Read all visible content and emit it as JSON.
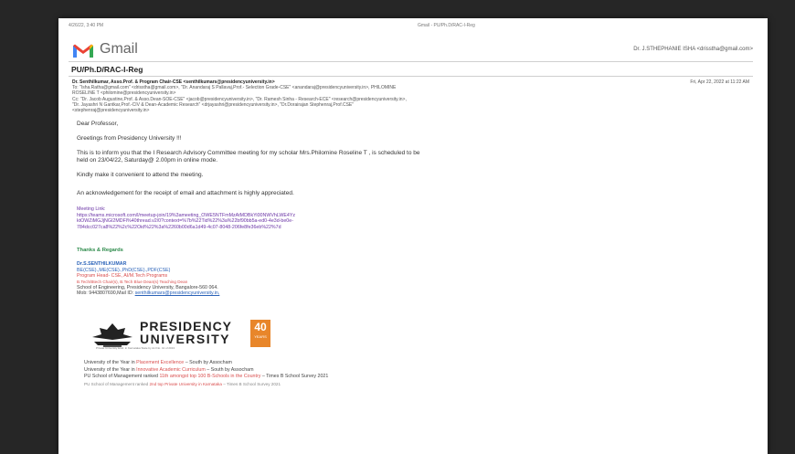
{
  "print_header": {
    "datetime": "4/26/22, 3:40 PM",
    "center": "Gmail - PU/Ph.D/RAC-I-Reg"
  },
  "gmail": {
    "brand": "Gmail",
    "account": "Dr. J.STHEPHANIE ISHA <drisstha@gmail.com>"
  },
  "subject": "PU/Ph.D/RAC-I-Reg",
  "sender": "Dr. Senthilkumar, Asso.Prof. & Program Chair-CSE <senthilkumars@presidencyuniversity.in>",
  "date": "Fri, Apr 22, 2022 at 11:22 AM",
  "recipients": [
    "To: \"Isha.Ratha@gmail.com\" <drisstha@gmail.com>, \"Dr. Anandaraj S Pallavaj,Prof.- Selection Grade-CSE\" <anandaraj@presidencyuniversity.in>, PHILOMINE",
    "ROSELINE T <philomine@presidencyuniversity.in>",
    "Cc: \"Dr. Jacob Augustine,Prof. & Asso.Dean-SOE-CSE\" <jacob@presidencyuniversity.in>, \"Dr. Ramesh Sinha - Research-ECE\" <research@presidencyuniversity.in>,",
    "\"Dr. Jayashri N Gantkar,Prof.-CIV & Dean-Academic Research\" <drjayashri@presidencyuniversity.in>, \"Dr.Dorairajan Stephenraj,Prof.CSE\"",
    "<stephenraj@presidencyuniversity.in>"
  ],
  "body": {
    "salutation": "Dear Professor,",
    "greeting": "Greetings from Presidency University !!!",
    "para1a": "This is to inform you that the I Research Advisory Committee meeting for my scholar Mrs.Philomine Roseline T , is scheduled to be",
    "para1b": "held on 23/04/22, Saturday@ 2.00pm in online mode.",
    "para2": "Kindly make it convenient to attend the meeting.",
    "para3": "An acknowledgement for the receipt of email and attachment is highly appreciated.",
    "meeting_label": "Meeting Link:",
    "meeting_link_1": "https://teams.microsoft.com/l/meetup-join/19%3ameeting_OWE5NTFmMzAtMDBkYi00NWVhLWE4Yz",
    "meeting_link_2": "ktOWZiMGJjNGI2MDFl%40thread.v2/0?context=%7b%22Tid%22%3a%22bf90bb5a-ed0-4e3d-be0e-",
    "meeting_link_3": "784dcc027ca8%22%2c%22Oid%22%3a%2260b00d6a1d49-4c07-8048-206fe8fe36eb%22%7d"
  },
  "signature": {
    "regards": "Thanks & Regards",
    "name": "Dr.S.SENTHILKUMAR",
    "degrees": "BE(CSE).,ME(CSE).,PhD(CSE).,PDF(CSE)",
    "role1": "Program Head- CSE, AI/M.Tech Programs",
    "role2": "B.Tech/Btech Chair(s), B.Tech Blue Dean(s) Teaching Dean",
    "address": "School of Engineering, Presidency University, Bangalore-560 064.",
    "contact_prefix": "Mob: 9443807690,Mail ID: ",
    "contact_email": "senthilkumars@presidencyuniversity.in,"
  },
  "logo": {
    "line1": "PRESIDENCY",
    "line2": "UNIVERSITY",
    "badge_num": "40",
    "badge_text": "YEARS",
    "tagline": "Private University Estd. in Karnataka State by Act No. 41 of 2013"
  },
  "footer": [
    {
      "a": "University of the Year in ",
      "b": "Placement Excellence",
      "c": " – South by Assocham"
    },
    {
      "a": "University of the Year in ",
      "b": "Innovative Academic Curriculum",
      "c": " – South by Assocham"
    },
    {
      "a": "PU School of Management ranked ",
      "b": "11th amongst top 100 B-Schools in the Country",
      "c": " – Times B School Survey 2021"
    },
    {
      "a": "PU School of Management ranked ",
      "b": "2nd top Private University in Karnataka",
      "c": " – Times B School Survey 2021"
    }
  ],
  "colors": {
    "gmail_red": "#ea4335",
    "accent_orange": "#e8862a",
    "link_purple": "#6b35a6"
  }
}
